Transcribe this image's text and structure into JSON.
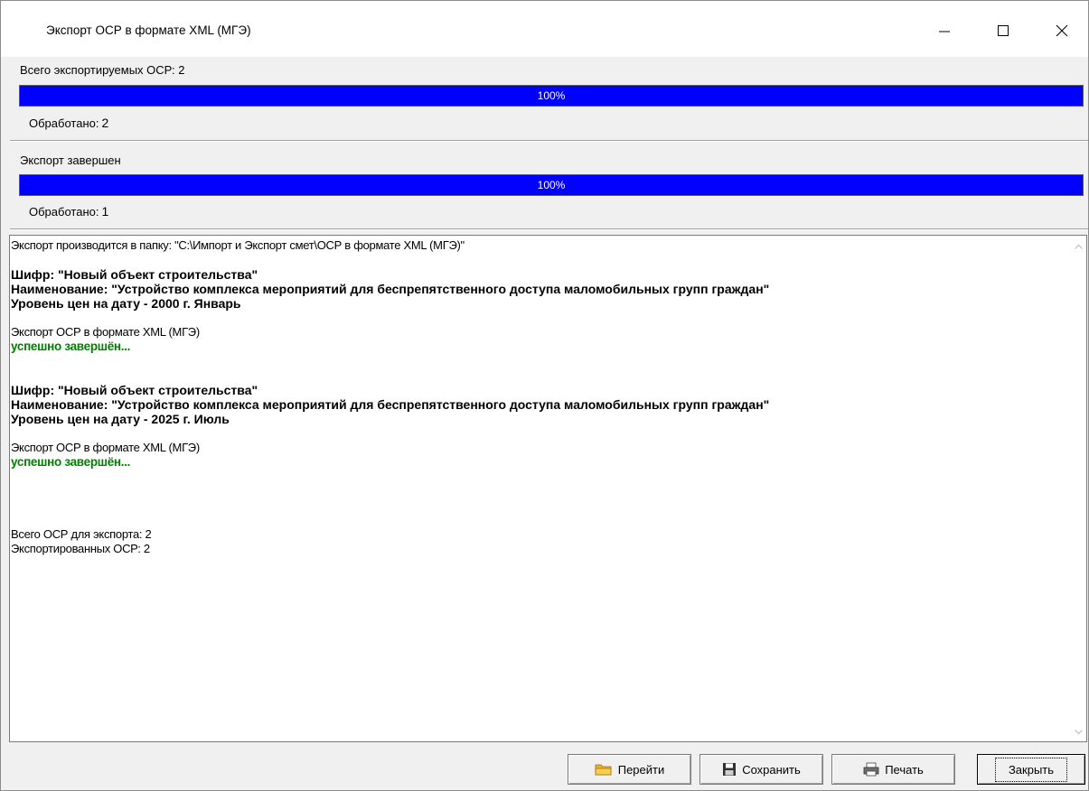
{
  "window": {
    "title": "Экспорт ОСР в формате XML (МГЭ)"
  },
  "section1": {
    "label": "Всего экспортируемых ОСР: 2",
    "progress_text": "100%",
    "progress_fraction": 1.0,
    "counter_label": "Обработано:",
    "counter_value": "2"
  },
  "section2": {
    "label": "Экспорт завершен",
    "progress_text": "100%",
    "progress_fraction": 1.0,
    "counter_label": "Обработано:",
    "counter_value": "1"
  },
  "log": {
    "lines": [
      {
        "text": "Экспорт производится в папку: \"C:\\Импорт и Экспорт смет\\ОСР в формате XML (МГЭ)\"",
        "style": "normal"
      },
      {
        "text": "",
        "style": "normal"
      },
      {
        "text": "Шифр: \"Новый объект строительства\"",
        "style": "bold"
      },
      {
        "text": "Наименование: \"Устройство комплекса мероприятий для беспрепятственного доступа маломобильных групп граждан\"",
        "style": "bold"
      },
      {
        "text": "Уровень цен на дату - 2000 г. Январь",
        "style": "bold"
      },
      {
        "text": "",
        "style": "normal"
      },
      {
        "text": "Экспорт ОСР в формате XML (МГЭ)",
        "style": "normal"
      },
      {
        "text": "успешно завершён...",
        "style": "ok"
      },
      {
        "text": "",
        "style": "normal"
      },
      {
        "text": "",
        "style": "normal"
      },
      {
        "text": "Шифр: \"Новый объект строительства\"",
        "style": "bold"
      },
      {
        "text": "Наименование: \"Устройство комплекса мероприятий для беспрепятственного доступа маломобильных групп граждан\"",
        "style": "bold"
      },
      {
        "text": "Уровень цен на дату - 2025 г. Июль",
        "style": "bold"
      },
      {
        "text": "",
        "style": "normal"
      },
      {
        "text": "Экспорт ОСР в формате XML (МГЭ)",
        "style": "normal"
      },
      {
        "text": "успешно завершён...",
        "style": "ok"
      },
      {
        "text": "",
        "style": "normal"
      },
      {
        "text": "",
        "style": "normal"
      },
      {
        "text": "",
        "style": "normal"
      },
      {
        "text": "",
        "style": "normal"
      },
      {
        "text": "Всего ОСР для экспорта: 2",
        "style": "normal"
      },
      {
        "text": "Экспортированных ОСР: 2",
        "style": "normal"
      }
    ]
  },
  "buttons": {
    "goto": {
      "label": "Перейти",
      "icon": "folder-icon"
    },
    "save": {
      "label": "Сохранить",
      "icon": "floppy-disk-icon"
    },
    "print": {
      "label": "Печать",
      "icon": "printer-icon"
    },
    "close": {
      "label": "Закрыть"
    }
  },
  "colors": {
    "progress_fill": "#0000ff",
    "success_text": "#008000"
  }
}
